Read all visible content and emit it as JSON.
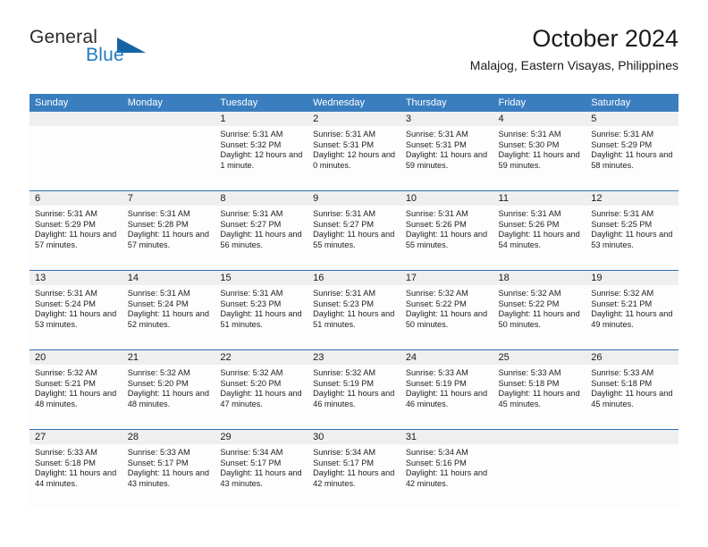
{
  "logo": {
    "word_one": "General",
    "word_two": "Blue",
    "triangle_color": "#1464a5",
    "blue_color": "#1f7bc1"
  },
  "header": {
    "title": "October 2024",
    "subtitle": "Malajog, Eastern Visayas, Philippines"
  },
  "theme": {
    "header_bg": "#3a7ec0",
    "row_divider": "#2c6fae",
    "daynum_band": "#efefef",
    "page_bg": "#ffffff"
  },
  "calendar": {
    "weekday_headers": [
      "Sunday",
      "Monday",
      "Tuesday",
      "Wednesday",
      "Thursday",
      "Friday",
      "Saturday"
    ],
    "weeks": [
      [
        {
          "day": "",
          "sunrise": "",
          "sunset": "",
          "daylight": "",
          "empty": true
        },
        {
          "day": "",
          "sunrise": "",
          "sunset": "",
          "daylight": "",
          "empty": true
        },
        {
          "day": "1",
          "sunrise": "Sunrise: 5:31 AM",
          "sunset": "Sunset: 5:32 PM",
          "daylight": "Daylight: 12 hours and 1 minute."
        },
        {
          "day": "2",
          "sunrise": "Sunrise: 5:31 AM",
          "sunset": "Sunset: 5:31 PM",
          "daylight": "Daylight: 12 hours and 0 minutes."
        },
        {
          "day": "3",
          "sunrise": "Sunrise: 5:31 AM",
          "sunset": "Sunset: 5:31 PM",
          "daylight": "Daylight: 11 hours and 59 minutes."
        },
        {
          "day": "4",
          "sunrise": "Sunrise: 5:31 AM",
          "sunset": "Sunset: 5:30 PM",
          "daylight": "Daylight: 11 hours and 59 minutes."
        },
        {
          "day": "5",
          "sunrise": "Sunrise: 5:31 AM",
          "sunset": "Sunset: 5:29 PM",
          "daylight": "Daylight: 11 hours and 58 minutes."
        }
      ],
      [
        {
          "day": "6",
          "sunrise": "Sunrise: 5:31 AM",
          "sunset": "Sunset: 5:29 PM",
          "daylight": "Daylight: 11 hours and 57 minutes."
        },
        {
          "day": "7",
          "sunrise": "Sunrise: 5:31 AM",
          "sunset": "Sunset: 5:28 PM",
          "daylight": "Daylight: 11 hours and 57 minutes."
        },
        {
          "day": "8",
          "sunrise": "Sunrise: 5:31 AM",
          "sunset": "Sunset: 5:27 PM",
          "daylight": "Daylight: 11 hours and 56 minutes."
        },
        {
          "day": "9",
          "sunrise": "Sunrise: 5:31 AM",
          "sunset": "Sunset: 5:27 PM",
          "daylight": "Daylight: 11 hours and 55 minutes."
        },
        {
          "day": "10",
          "sunrise": "Sunrise: 5:31 AM",
          "sunset": "Sunset: 5:26 PM",
          "daylight": "Daylight: 11 hours and 55 minutes."
        },
        {
          "day": "11",
          "sunrise": "Sunrise: 5:31 AM",
          "sunset": "Sunset: 5:26 PM",
          "daylight": "Daylight: 11 hours and 54 minutes."
        },
        {
          "day": "12",
          "sunrise": "Sunrise: 5:31 AM",
          "sunset": "Sunset: 5:25 PM",
          "daylight": "Daylight: 11 hours and 53 minutes."
        }
      ],
      [
        {
          "day": "13",
          "sunrise": "Sunrise: 5:31 AM",
          "sunset": "Sunset: 5:24 PM",
          "daylight": "Daylight: 11 hours and 53 minutes."
        },
        {
          "day": "14",
          "sunrise": "Sunrise: 5:31 AM",
          "sunset": "Sunset: 5:24 PM",
          "daylight": "Daylight: 11 hours and 52 minutes."
        },
        {
          "day": "15",
          "sunrise": "Sunrise: 5:31 AM",
          "sunset": "Sunset: 5:23 PM",
          "daylight": "Daylight: 11 hours and 51 minutes."
        },
        {
          "day": "16",
          "sunrise": "Sunrise: 5:31 AM",
          "sunset": "Sunset: 5:23 PM",
          "daylight": "Daylight: 11 hours and 51 minutes."
        },
        {
          "day": "17",
          "sunrise": "Sunrise: 5:32 AM",
          "sunset": "Sunset: 5:22 PM",
          "daylight": "Daylight: 11 hours and 50 minutes."
        },
        {
          "day": "18",
          "sunrise": "Sunrise: 5:32 AM",
          "sunset": "Sunset: 5:22 PM",
          "daylight": "Daylight: 11 hours and 50 minutes."
        },
        {
          "day": "19",
          "sunrise": "Sunrise: 5:32 AM",
          "sunset": "Sunset: 5:21 PM",
          "daylight": "Daylight: 11 hours and 49 minutes."
        }
      ],
      [
        {
          "day": "20",
          "sunrise": "Sunrise: 5:32 AM",
          "sunset": "Sunset: 5:21 PM",
          "daylight": "Daylight: 11 hours and 48 minutes."
        },
        {
          "day": "21",
          "sunrise": "Sunrise: 5:32 AM",
          "sunset": "Sunset: 5:20 PM",
          "daylight": "Daylight: 11 hours and 48 minutes."
        },
        {
          "day": "22",
          "sunrise": "Sunrise: 5:32 AM",
          "sunset": "Sunset: 5:20 PM",
          "daylight": "Daylight: 11 hours and 47 minutes."
        },
        {
          "day": "23",
          "sunrise": "Sunrise: 5:32 AM",
          "sunset": "Sunset: 5:19 PM",
          "daylight": "Daylight: 11 hours and 46 minutes."
        },
        {
          "day": "24",
          "sunrise": "Sunrise: 5:33 AM",
          "sunset": "Sunset: 5:19 PM",
          "daylight": "Daylight: 11 hours and 46 minutes."
        },
        {
          "day": "25",
          "sunrise": "Sunrise: 5:33 AM",
          "sunset": "Sunset: 5:18 PM",
          "daylight": "Daylight: 11 hours and 45 minutes."
        },
        {
          "day": "26",
          "sunrise": "Sunrise: 5:33 AM",
          "sunset": "Sunset: 5:18 PM",
          "daylight": "Daylight: 11 hours and 45 minutes."
        }
      ],
      [
        {
          "day": "27",
          "sunrise": "Sunrise: 5:33 AM",
          "sunset": "Sunset: 5:18 PM",
          "daylight": "Daylight: 11 hours and 44 minutes."
        },
        {
          "day": "28",
          "sunrise": "Sunrise: 5:33 AM",
          "sunset": "Sunset: 5:17 PM",
          "daylight": "Daylight: 11 hours and 43 minutes."
        },
        {
          "day": "29",
          "sunrise": "Sunrise: 5:34 AM",
          "sunset": "Sunset: 5:17 PM",
          "daylight": "Daylight: 11 hours and 43 minutes."
        },
        {
          "day": "30",
          "sunrise": "Sunrise: 5:34 AM",
          "sunset": "Sunset: 5:17 PM",
          "daylight": "Daylight: 11 hours and 42 minutes."
        },
        {
          "day": "31",
          "sunrise": "Sunrise: 5:34 AM",
          "sunset": "Sunset: 5:16 PM",
          "daylight": "Daylight: 11 hours and 42 minutes."
        },
        {
          "day": "",
          "sunrise": "",
          "sunset": "",
          "daylight": "",
          "empty": true
        },
        {
          "day": "",
          "sunrise": "",
          "sunset": "",
          "daylight": "",
          "empty": true
        }
      ]
    ]
  }
}
